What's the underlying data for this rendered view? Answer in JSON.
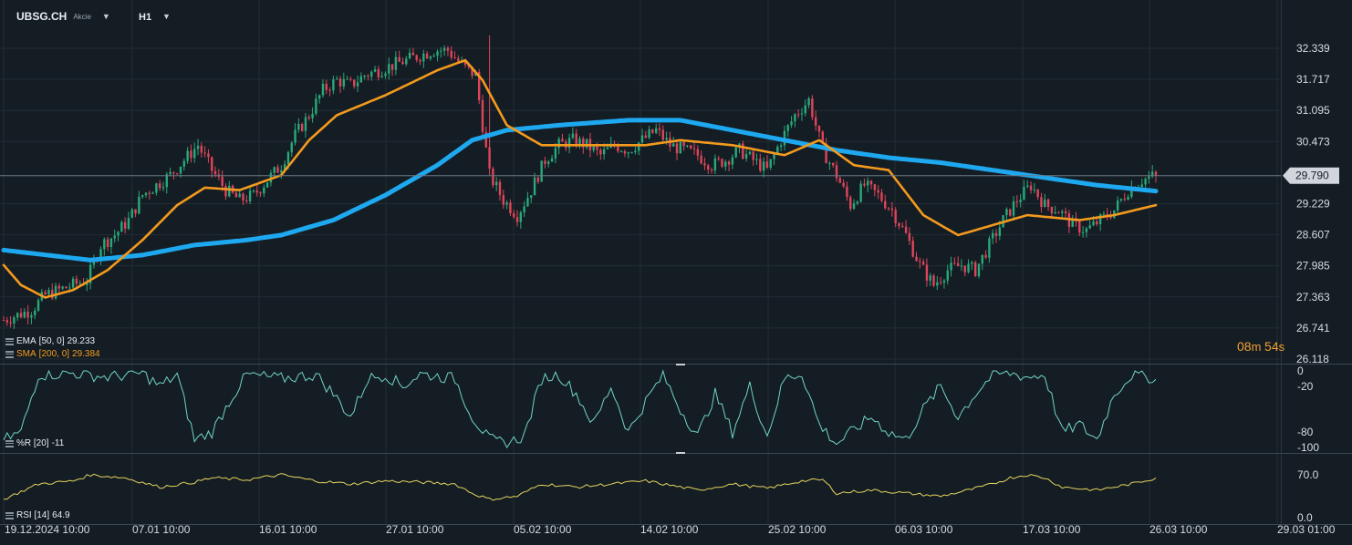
{
  "header": {
    "symbol": "UBSG.CH",
    "market": "Akcie",
    "timeframe": "H1"
  },
  "colors": {
    "background": "#151d24",
    "grid": "#222c35",
    "up_candle": "#27a97a",
    "down_candle": "#e0445a",
    "ema": "#1ea8f0",
    "sma": "#f39a1e",
    "wr": "#6fd6c0",
    "rsi": "#e3d25e",
    "axis_text": "#d6dce2",
    "countdown": "#f0a030"
  },
  "main_panel": {
    "y_ticks": [
      "32.339",
      "31.717",
      "31.095",
      "30.473",
      "29.790",
      "29.229",
      "28.607",
      "27.985",
      "27.363",
      "26.741",
      "26.118"
    ],
    "current_price": "29.790",
    "indicators": [
      {
        "name": "EMA",
        "params": "[50, 0]",
        "value": "29.233"
      },
      {
        "name": "SMA",
        "params": "[200, 0]",
        "value": "29.384"
      }
    ],
    "countdown": {
      "minutes": "08",
      "seconds": "54"
    }
  },
  "wr_panel": {
    "label": "%R [20]",
    "value": "-11",
    "y_ticks": [
      "0",
      "-20",
      "-80",
      "-100"
    ]
  },
  "rsi_panel": {
    "label": "RSI [14]",
    "value": "64.9",
    "y_ticks": [
      "70.0",
      "0.0"
    ]
  },
  "x_axis": {
    "labels": [
      "19.12.2024  10:00",
      "07.01  10:00",
      "16.01  10:00",
      "27.01  10:00",
      "05.02  10:00",
      "14.02  10:00",
      "25.02  10:00",
      "06.03  10:00",
      "17.03  10:00",
      "26.03  10:00",
      "29.03  01:00"
    ]
  },
  "chart_data": [
    {
      "type": "candlestick",
      "title": "UBSG.CH H1",
      "ylim": [
        26.118,
        32.6
      ],
      "x_labels": [
        "19.12.2024  10:00",
        "07.01  10:00",
        "16.01  10:00",
        "27.01  10:00",
        "05.02  10:00",
        "14.02  10:00",
        "25.02  10:00",
        "06.03  10:00",
        "17.03  10:00",
        "26.03  10:00"
      ],
      "close_anchors": [
        [
          0,
          26.9
        ],
        [
          4,
          27.0
        ],
        [
          8,
          27.1
        ],
        [
          12,
          27.4
        ],
        [
          16,
          27.5
        ],
        [
          20,
          27.6
        ],
        [
          24,
          27.7
        ],
        [
          28,
          28.4
        ],
        [
          32,
          28.6
        ],
        [
          36,
          28.9
        ],
        [
          40,
          29.4
        ],
        [
          44,
          29.6
        ],
        [
          48,
          29.8
        ],
        [
          52,
          30.1
        ],
        [
          56,
          30.4
        ],
        [
          60,
          29.9
        ],
        [
          64,
          29.5
        ],
        [
          68,
          29.3
        ],
        [
          72,
          29.4
        ],
        [
          76,
          29.7
        ],
        [
          80,
          30.0
        ],
        [
          84,
          30.6
        ],
        [
          88,
          31.0
        ],
        [
          92,
          31.5
        ],
        [
          96,
          31.7
        ],
        [
          100,
          31.6
        ],
        [
          104,
          31.8
        ],
        [
          108,
          31.9
        ],
        [
          112,
          32.0
        ],
        [
          116,
          32.1
        ],
        [
          120,
          32.2
        ],
        [
          124,
          32.3
        ],
        [
          128,
          32.3
        ],
        [
          132,
          32.0
        ],
        [
          136,
          31.8
        ],
        [
          140,
          29.8
        ],
        [
          144,
          29.3
        ],
        [
          148,
          29.0
        ],
        [
          152,
          29.5
        ],
        [
          156,
          30.1
        ],
        [
          160,
          30.4
        ],
        [
          164,
          30.5
        ],
        [
          168,
          30.4
        ],
        [
          172,
          30.2
        ],
        [
          176,
          30.4
        ],
        [
          180,
          30.3
        ],
        [
          184,
          30.5
        ],
        [
          188,
          30.7
        ],
        [
          192,
          30.4
        ],
        [
          196,
          30.3
        ],
        [
          200,
          30.2
        ],
        [
          204,
          30.0
        ],
        [
          208,
          30.1
        ],
        [
          212,
          30.3
        ],
        [
          216,
          30.1
        ],
        [
          220,
          29.9
        ],
        [
          224,
          30.5
        ],
        [
          228,
          31.0
        ],
        [
          232,
          31.3
        ],
        [
          236,
          30.3
        ],
        [
          240,
          29.8
        ],
        [
          244,
          29.2
        ],
        [
          248,
          29.6
        ],
        [
          252,
          29.4
        ],
        [
          256,
          29.1
        ],
        [
          260,
          28.6
        ],
        [
          264,
          28.0
        ],
        [
          268,
          27.6
        ],
        [
          272,
          27.9
        ],
        [
          276,
          28.0
        ],
        [
          280,
          27.9
        ],
        [
          284,
          28.4
        ],
        [
          288,
          28.9
        ],
        [
          292,
          29.3
        ],
        [
          296,
          29.6
        ],
        [
          300,
          29.2
        ],
        [
          304,
          29.1
        ],
        [
          308,
          28.8
        ],
        [
          312,
          28.7
        ],
        [
          316,
          28.9
        ],
        [
          320,
          29.1
        ],
        [
          324,
          29.5
        ],
        [
          328,
          29.7
        ],
        [
          332,
          29.8
        ]
      ],
      "ema_anchors": [
        [
          0,
          28.3
        ],
        [
          25,
          28.1
        ],
        [
          40,
          28.2
        ],
        [
          55,
          28.4
        ],
        [
          70,
          28.5
        ],
        [
          80,
          28.6
        ],
        [
          95,
          28.9
        ],
        [
          110,
          29.4
        ],
        [
          125,
          30.0
        ],
        [
          135,
          30.5
        ],
        [
          145,
          30.7
        ],
        [
          160,
          30.8
        ],
        [
          180,
          30.9
        ],
        [
          195,
          30.9
        ],
        [
          210,
          30.7
        ],
        [
          225,
          30.5
        ],
        [
          240,
          30.3
        ],
        [
          255,
          30.15
        ],
        [
          270,
          30.05
        ],
        [
          285,
          29.9
        ],
        [
          300,
          29.75
        ],
        [
          315,
          29.6
        ],
        [
          332,
          29.48
        ]
      ],
      "sma_anchors": [
        [
          0,
          28.0
        ],
        [
          5,
          27.6
        ],
        [
          12,
          27.35
        ],
        [
          20,
          27.5
        ],
        [
          30,
          27.9
        ],
        [
          40,
          28.5
        ],
        [
          50,
          29.2
        ],
        [
          58,
          29.55
        ],
        [
          68,
          29.5
        ],
        [
          80,
          29.8
        ],
        [
          88,
          30.5
        ],
        [
          96,
          31.0
        ],
        [
          110,
          31.4
        ],
        [
          125,
          31.9
        ],
        [
          133,
          32.1
        ],
        [
          138,
          31.7
        ],
        [
          145,
          30.8
        ],
        [
          155,
          30.4
        ],
        [
          170,
          30.4
        ],
        [
          185,
          30.4
        ],
        [
          195,
          30.5
        ],
        [
          210,
          30.4
        ],
        [
          225,
          30.2
        ],
        [
          235,
          30.5
        ],
        [
          245,
          30.0
        ],
        [
          255,
          29.9
        ],
        [
          265,
          29.0
        ],
        [
          275,
          28.6
        ],
        [
          285,
          28.8
        ],
        [
          295,
          29.0
        ],
        [
          310,
          28.9
        ],
        [
          320,
          29.0
        ],
        [
          332,
          29.2
        ]
      ],
      "last_close": 29.79,
      "series": [
        {
          "name": "EMA [50, 0]",
          "last": 29.233
        },
        {
          "name": "SMA [200, 0]",
          "last": 29.384
        }
      ]
    },
    {
      "type": "line",
      "title": "%R [20]",
      "ylim": [
        -100,
        0
      ],
      "y_ticks": [
        0,
        -20,
        -80,
        -100
      ],
      "anchors": [
        [
          0,
          -90
        ],
        [
          5,
          -80
        ],
        [
          10,
          -5
        ],
        [
          20,
          -3
        ],
        [
          30,
          -8
        ],
        [
          40,
          -3
        ],
        [
          45,
          -20
        ],
        [
          50,
          -5
        ],
        [
          55,
          -90
        ],
        [
          60,
          -80
        ],
        [
          65,
          -40
        ],
        [
          70,
          -5
        ],
        [
          80,
          -10
        ],
        [
          90,
          -5
        ],
        [
          95,
          -30
        ],
        [
          100,
          -60
        ],
        [
          105,
          -10
        ],
        [
          110,
          -5
        ],
        [
          115,
          -20
        ],
        [
          120,
          -4
        ],
        [
          130,
          -10
        ],
        [
          135,
          -60
        ],
        [
          140,
          -90
        ],
        [
          145,
          -95
        ],
        [
          150,
          -85
        ],
        [
          155,
          -10
        ],
        [
          160,
          -5
        ],
        [
          165,
          -30
        ],
        [
          170,
          -70
        ],
        [
          175,
          -20
        ],
        [
          180,
          -80
        ],
        [
          185,
          -40
        ],
        [
          190,
          -5
        ],
        [
          195,
          -50
        ],
        [
          200,
          -85
        ],
        [
          205,
          -30
        ],
        [
          210,
          -80
        ],
        [
          215,
          -20
        ],
        [
          220,
          -85
        ],
        [
          225,
          -10
        ],
        [
          230,
          -3
        ],
        [
          235,
          -70
        ],
        [
          240,
          -95
        ],
        [
          250,
          -60
        ],
        [
          255,
          -80
        ],
        [
          260,
          -90
        ],
        [
          265,
          -50
        ],
        [
          270,
          -20
        ],
        [
          275,
          -60
        ],
        [
          280,
          -30
        ],
        [
          285,
          -5
        ],
        [
          290,
          -3
        ],
        [
          295,
          -8
        ],
        [
          300,
          -5
        ],
        [
          305,
          -80
        ],
        [
          310,
          -70
        ],
        [
          315,
          -90
        ],
        [
          320,
          -30
        ],
        [
          325,
          -5
        ],
        [
          330,
          -8
        ],
        [
          332,
          -11
        ]
      ],
      "last": -11
    },
    {
      "type": "line",
      "title": "RSI [14]",
      "ylim": [
        0,
        80
      ],
      "y_ticks": [
        70,
        0
      ],
      "anchors": [
        [
          0,
          30
        ],
        [
          10,
          55
        ],
        [
          20,
          60
        ],
        [
          25,
          70
        ],
        [
          35,
          65
        ],
        [
          45,
          50
        ],
        [
          55,
          58
        ],
        [
          60,
          65
        ],
        [
          70,
          62
        ],
        [
          80,
          70
        ],
        [
          90,
          60
        ],
        [
          100,
          55
        ],
        [
          110,
          60
        ],
        [
          120,
          58
        ],
        [
          130,
          55
        ],
        [
          135,
          40
        ],
        [
          140,
          30
        ],
        [
          148,
          35
        ],
        [
          155,
          55
        ],
        [
          165,
          50
        ],
        [
          175,
          55
        ],
        [
          185,
          60
        ],
        [
          190,
          55
        ],
        [
          200,
          45
        ],
        [
          210,
          55
        ],
        [
          220,
          48
        ],
        [
          230,
          60
        ],
        [
          236,
          62
        ],
        [
          240,
          40
        ],
        [
          250,
          45
        ],
        [
          260,
          40
        ],
        [
          270,
          35
        ],
        [
          278,
          45
        ],
        [
          285,
          55
        ],
        [
          290,
          65
        ],
        [
          295,
          70
        ],
        [
          300,
          65
        ],
        [
          305,
          50
        ],
        [
          315,
          45
        ],
        [
          325,
          55
        ],
        [
          332,
          64.9
        ]
      ],
      "last": 64.9
    }
  ]
}
